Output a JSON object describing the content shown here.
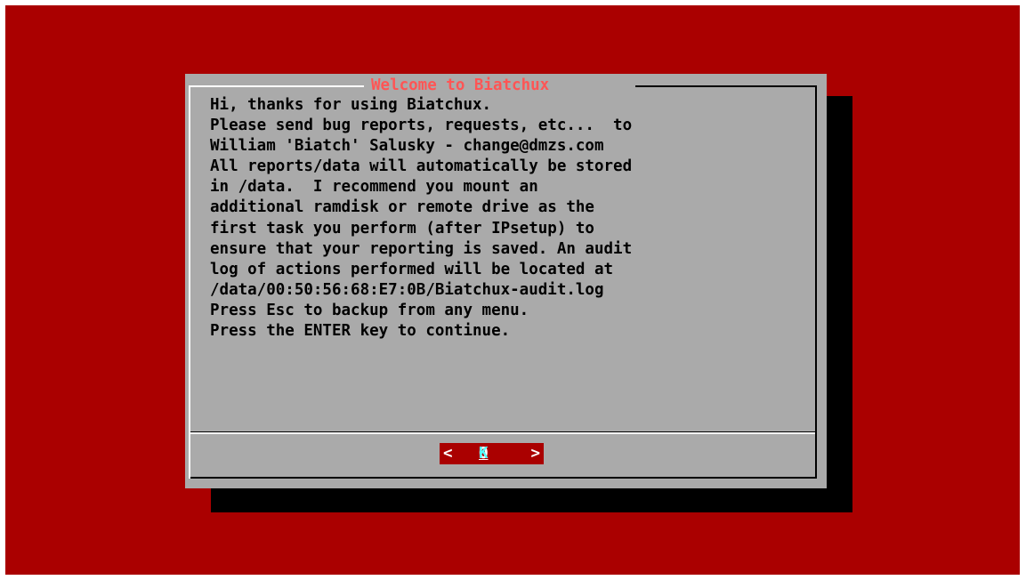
{
  "dialog": {
    "title": "Welcome to Biatchux",
    "message_lines": [
      "Hi, thanks for using Biatchux.",
      "Please send bug reports, requests, etc...  to",
      "William 'Biatch' Salusky - change@dmzs.com",
      "All reports/data will automatically be stored",
      "in /data.  I recommend you mount an",
      "additional ramdisk or remote drive as the",
      "first task you perform (after IPsetup) to",
      "ensure that your reporting is saved. An audit",
      "log of actions performed will be located at",
      "/data/00:50:56:68:E7:0B/Biatchux-audit.log",
      "Press Esc to backup from any menu.",
      "Press the ENTER key to continue."
    ],
    "ok_button": {
      "left_bracket": "<",
      "hotkey": "O",
      "label_rest": "K",
      "right_bracket": ">"
    }
  },
  "colors": {
    "screen_background": "#aa0000",
    "dialog_background": "#aaaaaa",
    "title_text": "#ff5555",
    "button_background": "#aa0000",
    "button_label": "#55ffff"
  }
}
